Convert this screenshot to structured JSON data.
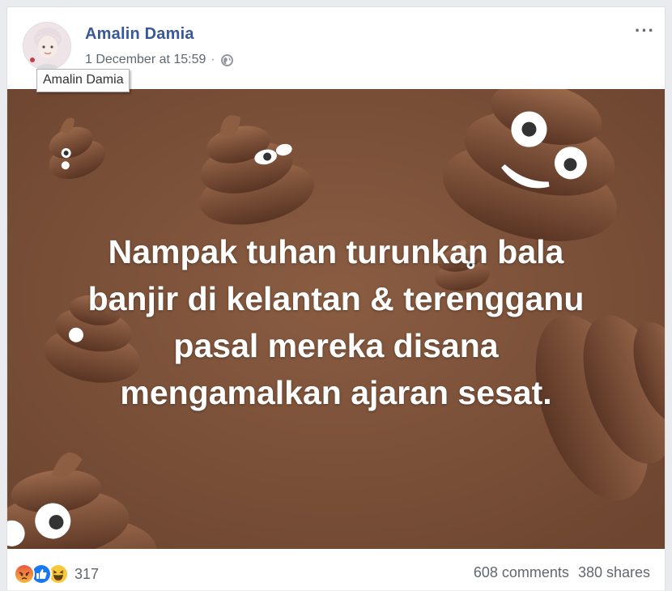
{
  "post": {
    "author": "Amalin Damia",
    "timestamp": "1 December at 15:59",
    "separator": "·",
    "privacy_icon": "globe-icon",
    "more_icon": "···",
    "tooltip": "Amalin Damia"
  },
  "image": {
    "lines": [
      "Nampak tuhan turunkan bala",
      "banjir di kelantan & terengganu",
      "pasal mereka disana",
      "mengamalkan ajaran sesat."
    ],
    "background_color": "#7a5138"
  },
  "footer": {
    "reaction_icons": [
      "angry-icon",
      "like-icon",
      "haha-icon"
    ],
    "reaction_count": "317",
    "comments": "608 comments",
    "shares": "380 shares"
  }
}
